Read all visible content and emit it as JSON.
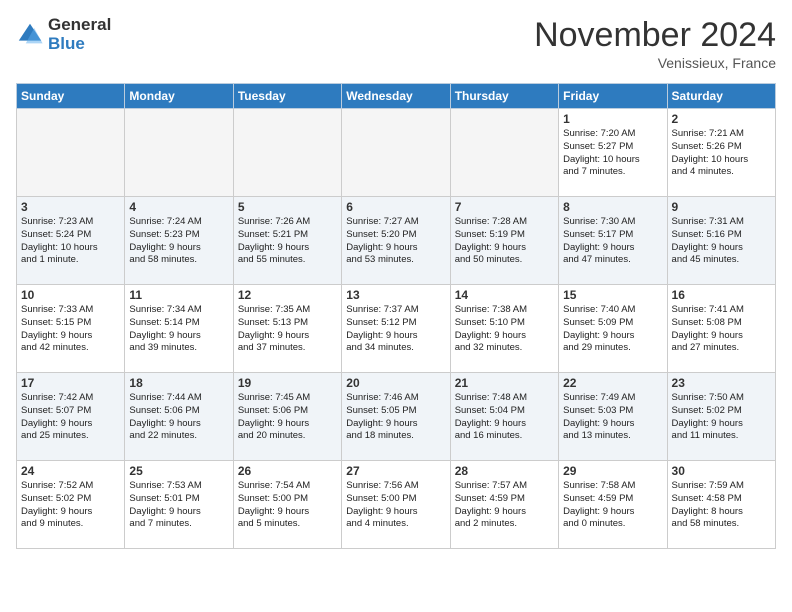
{
  "header": {
    "logo_general": "General",
    "logo_blue": "Blue",
    "month_title": "November 2024",
    "subtitle": "Venissieux, France"
  },
  "days_of_week": [
    "Sunday",
    "Monday",
    "Tuesday",
    "Wednesday",
    "Thursday",
    "Friday",
    "Saturday"
  ],
  "weeks": [
    [
      {
        "day": "",
        "info": ""
      },
      {
        "day": "",
        "info": ""
      },
      {
        "day": "",
        "info": ""
      },
      {
        "day": "",
        "info": ""
      },
      {
        "day": "",
        "info": ""
      },
      {
        "day": "1",
        "info": "Sunrise: 7:20 AM\nSunset: 5:27 PM\nDaylight: 10 hours\nand 7 minutes."
      },
      {
        "day": "2",
        "info": "Sunrise: 7:21 AM\nSunset: 5:26 PM\nDaylight: 10 hours\nand 4 minutes."
      }
    ],
    [
      {
        "day": "3",
        "info": "Sunrise: 7:23 AM\nSunset: 5:24 PM\nDaylight: 10 hours\nand 1 minute."
      },
      {
        "day": "4",
        "info": "Sunrise: 7:24 AM\nSunset: 5:23 PM\nDaylight: 9 hours\nand 58 minutes."
      },
      {
        "day": "5",
        "info": "Sunrise: 7:26 AM\nSunset: 5:21 PM\nDaylight: 9 hours\nand 55 minutes."
      },
      {
        "day": "6",
        "info": "Sunrise: 7:27 AM\nSunset: 5:20 PM\nDaylight: 9 hours\nand 53 minutes."
      },
      {
        "day": "7",
        "info": "Sunrise: 7:28 AM\nSunset: 5:19 PM\nDaylight: 9 hours\nand 50 minutes."
      },
      {
        "day": "8",
        "info": "Sunrise: 7:30 AM\nSunset: 5:17 PM\nDaylight: 9 hours\nand 47 minutes."
      },
      {
        "day": "9",
        "info": "Sunrise: 7:31 AM\nSunset: 5:16 PM\nDaylight: 9 hours\nand 45 minutes."
      }
    ],
    [
      {
        "day": "10",
        "info": "Sunrise: 7:33 AM\nSunset: 5:15 PM\nDaylight: 9 hours\nand 42 minutes."
      },
      {
        "day": "11",
        "info": "Sunrise: 7:34 AM\nSunset: 5:14 PM\nDaylight: 9 hours\nand 39 minutes."
      },
      {
        "day": "12",
        "info": "Sunrise: 7:35 AM\nSunset: 5:13 PM\nDaylight: 9 hours\nand 37 minutes."
      },
      {
        "day": "13",
        "info": "Sunrise: 7:37 AM\nSunset: 5:12 PM\nDaylight: 9 hours\nand 34 minutes."
      },
      {
        "day": "14",
        "info": "Sunrise: 7:38 AM\nSunset: 5:10 PM\nDaylight: 9 hours\nand 32 minutes."
      },
      {
        "day": "15",
        "info": "Sunrise: 7:40 AM\nSunset: 5:09 PM\nDaylight: 9 hours\nand 29 minutes."
      },
      {
        "day": "16",
        "info": "Sunrise: 7:41 AM\nSunset: 5:08 PM\nDaylight: 9 hours\nand 27 minutes."
      }
    ],
    [
      {
        "day": "17",
        "info": "Sunrise: 7:42 AM\nSunset: 5:07 PM\nDaylight: 9 hours\nand 25 minutes."
      },
      {
        "day": "18",
        "info": "Sunrise: 7:44 AM\nSunset: 5:06 PM\nDaylight: 9 hours\nand 22 minutes."
      },
      {
        "day": "19",
        "info": "Sunrise: 7:45 AM\nSunset: 5:06 PM\nDaylight: 9 hours\nand 20 minutes."
      },
      {
        "day": "20",
        "info": "Sunrise: 7:46 AM\nSunset: 5:05 PM\nDaylight: 9 hours\nand 18 minutes."
      },
      {
        "day": "21",
        "info": "Sunrise: 7:48 AM\nSunset: 5:04 PM\nDaylight: 9 hours\nand 16 minutes."
      },
      {
        "day": "22",
        "info": "Sunrise: 7:49 AM\nSunset: 5:03 PM\nDaylight: 9 hours\nand 13 minutes."
      },
      {
        "day": "23",
        "info": "Sunrise: 7:50 AM\nSunset: 5:02 PM\nDaylight: 9 hours\nand 11 minutes."
      }
    ],
    [
      {
        "day": "24",
        "info": "Sunrise: 7:52 AM\nSunset: 5:02 PM\nDaylight: 9 hours\nand 9 minutes."
      },
      {
        "day": "25",
        "info": "Sunrise: 7:53 AM\nSunset: 5:01 PM\nDaylight: 9 hours\nand 7 minutes."
      },
      {
        "day": "26",
        "info": "Sunrise: 7:54 AM\nSunset: 5:00 PM\nDaylight: 9 hours\nand 5 minutes."
      },
      {
        "day": "27",
        "info": "Sunrise: 7:56 AM\nSunset: 5:00 PM\nDaylight: 9 hours\nand 4 minutes."
      },
      {
        "day": "28",
        "info": "Sunrise: 7:57 AM\nSunset: 4:59 PM\nDaylight: 9 hours\nand 2 minutes."
      },
      {
        "day": "29",
        "info": "Sunrise: 7:58 AM\nSunset: 4:59 PM\nDaylight: 9 hours\nand 0 minutes."
      },
      {
        "day": "30",
        "info": "Sunrise: 7:59 AM\nSunset: 4:58 PM\nDaylight: 8 hours\nand 58 minutes."
      }
    ]
  ]
}
